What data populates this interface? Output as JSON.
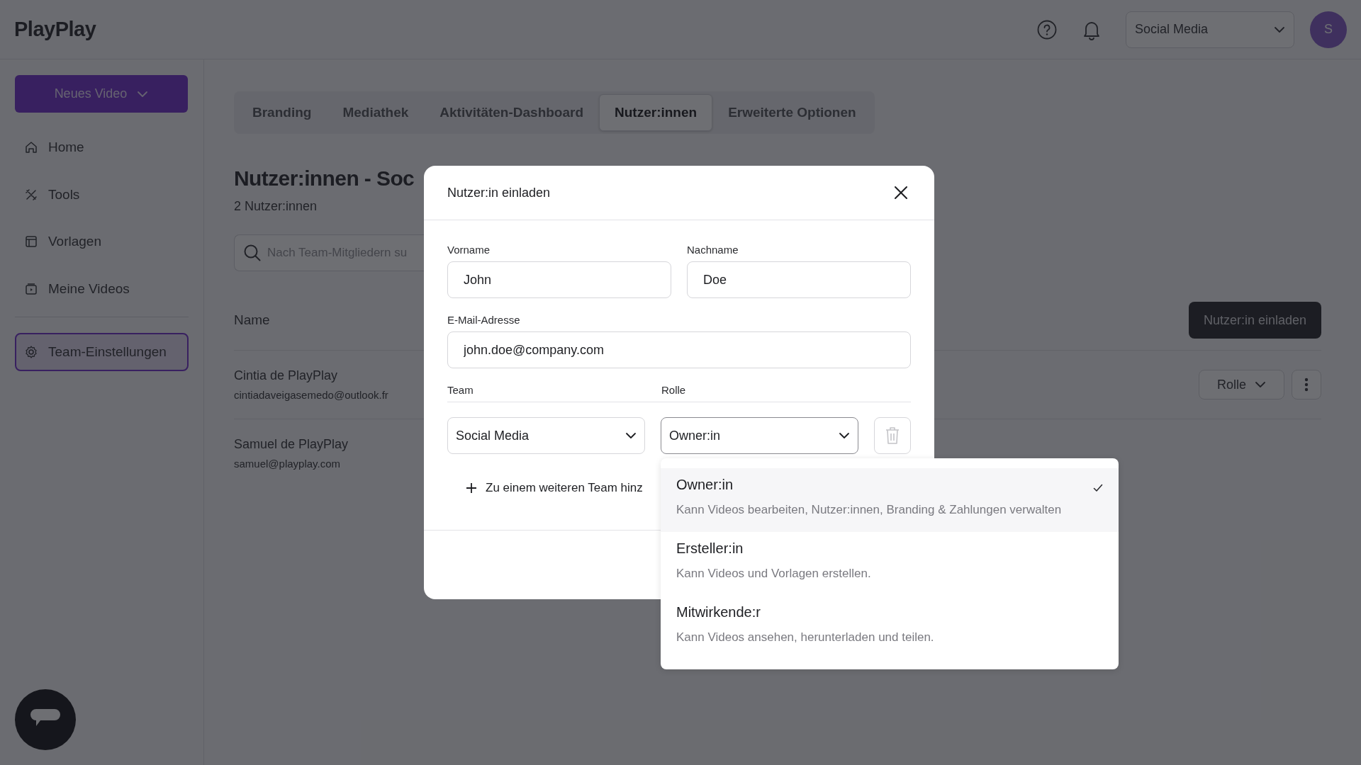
{
  "header": {
    "logo": "PlayPlay",
    "team_selector": "Social Media",
    "avatar": "S"
  },
  "sidebar": {
    "new_button": "Neues Video",
    "items": [
      {
        "label": "Home",
        "selected": false
      },
      {
        "label": "Tools",
        "selected": false
      },
      {
        "label": "Vorlagen",
        "selected": false
      },
      {
        "label": "Meine Videos",
        "selected": false
      }
    ],
    "footer_items": [
      {
        "label": "Team-Einstellungen",
        "selected": true
      }
    ]
  },
  "tabs": [
    {
      "label": "Branding",
      "selected": false
    },
    {
      "label": "Mediathek",
      "selected": false
    },
    {
      "label": "Aktivitäten-Dashboard",
      "selected": false
    },
    {
      "label": "Nutzer:innen",
      "selected": true
    },
    {
      "label": "Erweiterte Optionen",
      "selected": false
    }
  ],
  "page": {
    "title": "Nutzer:innen - Soc",
    "count": "2 Nutzer:innen",
    "search": {
      "placeholder": "Nach Team-Mitgliedern su"
    },
    "invite_button": "Nutzer:in einladen",
    "columns": [
      "Name"
    ],
    "users": [
      {
        "name": "Cintia de PlayPlay",
        "email": "cintiadaveigasemedo@outlook.fr",
        "role_button": "Rolle"
      },
      {
        "name": "Samuel de PlayPlay",
        "email": "samuel@playplay.com"
      }
    ]
  },
  "modal": {
    "title": "Nutzer:in einladen",
    "fields": [
      {
        "label": "Vorname",
        "value": "John"
      },
      {
        "label": "Nachname",
        "value": "Doe"
      },
      {
        "label": "E-Mail-Adresse",
        "value": "john.doe@company.com"
      }
    ],
    "team_label": "Team",
    "role_label": "Rolle",
    "team_value": "Social Media",
    "role_value": "Owner:in",
    "add_team": "Zu einem weiteren Team hinz"
  },
  "role_menu": {
    "options": [
      {
        "title": "Owner:in",
        "description": "Kann Videos bearbeiten, Nutzer:innen, Branding & Zahlungen verwalten",
        "selected": true
      },
      {
        "title": "Ersteller:in",
        "description": "Kann Videos und Vorlagen erstellen.",
        "selected": false
      },
      {
        "title": "Mitwirkende:r",
        "description": "Kann Videos ansehen, herunterladen und teilen.",
        "selected": false
      }
    ]
  }
}
